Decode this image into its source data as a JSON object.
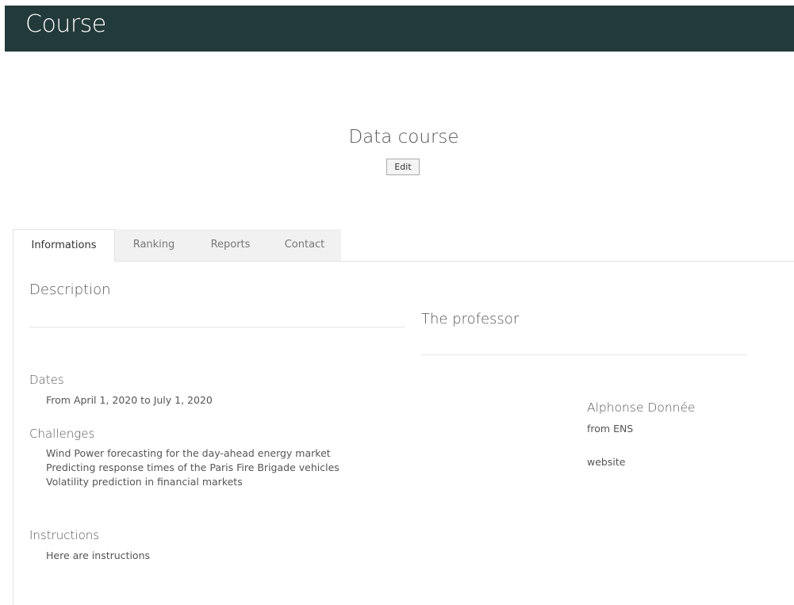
{
  "header": {
    "title": "Course"
  },
  "course": {
    "title": "Data course",
    "edit_label": "Edit"
  },
  "tabs": [
    {
      "label": "Informations",
      "active": true
    },
    {
      "label": "Ranking",
      "active": false
    },
    {
      "label": "Reports",
      "active": false
    },
    {
      "label": "Contact",
      "active": false
    }
  ],
  "informations": {
    "description_heading": "Description",
    "dates_heading": "Dates",
    "dates_text": "From April 1, 2020 to July 1, 2020",
    "challenges_heading": "Challenges",
    "challenges": [
      "Wind Power forecasting for the day-ahead energy market",
      "Predicting response times of the Paris Fire Brigade vehicles",
      "Volatility prediction in financial markets"
    ],
    "instructions_heading": "Instructions",
    "instructions_text": "Here are instructions"
  },
  "professor": {
    "heading": "The professor",
    "name": "Alphonse Donnée",
    "affiliation": "from ENS",
    "website_label": "website"
  },
  "colors": {
    "header_bg": "#233a3a",
    "tab_inactive_bg": "#f1f1f1",
    "text": "#555555"
  }
}
